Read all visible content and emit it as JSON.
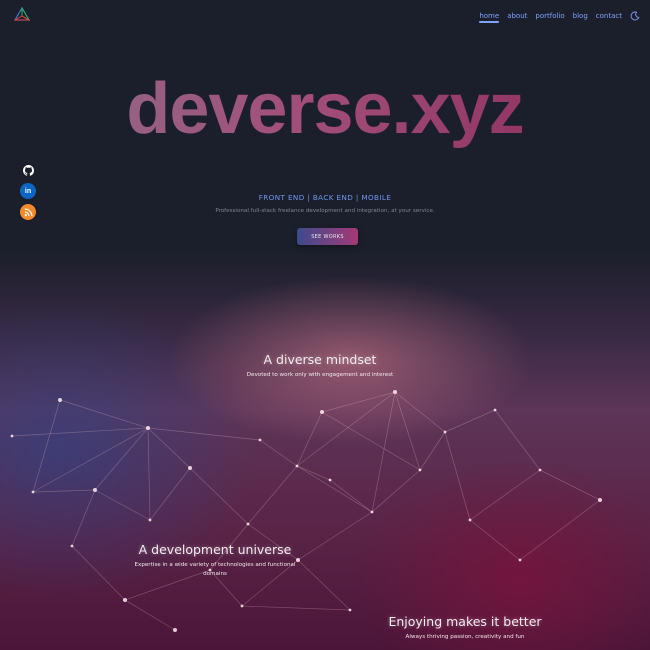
{
  "header": {
    "logo_icon": "triangle-logo-icon",
    "nav": [
      {
        "label": "home",
        "active": true
      },
      {
        "label": "about",
        "active": false
      },
      {
        "label": "portfolio",
        "active": false
      },
      {
        "label": "blog",
        "active": false
      },
      {
        "label": "contact",
        "active": false
      }
    ],
    "theme_toggle_icon": "moon-toggle-icon"
  },
  "social": [
    {
      "icon": "github-icon",
      "glyph": "",
      "color": "#1b1f2b"
    },
    {
      "icon": "linkedin-icon",
      "glyph": "in",
      "color": "#0a66c2"
    },
    {
      "icon": "rss-icon",
      "glyph": "",
      "color": "#f48b2a"
    }
  ],
  "hero": {
    "brand": "deverse.xyz",
    "services": "FRONT END | BACK END | MOBILE",
    "tagline": "Professional full-stack freelance development and integration, at your service.",
    "cta_label": "SEE WORKS"
  },
  "features": [
    {
      "title": "A diverse mindset",
      "text": "Devoted to work only with engagement and interest"
    },
    {
      "title": "A development universe",
      "text": "Expertise in a wide variety of technologies and functional domains"
    },
    {
      "title": "Enjoying makes it better",
      "text": "Always thriving passion, creativity and fun"
    }
  ],
  "colors": {
    "accent": "#7ea2ff",
    "background": "#1b1f2b",
    "cta_start": "#3d4a8e",
    "cta_end": "#a53a74"
  }
}
